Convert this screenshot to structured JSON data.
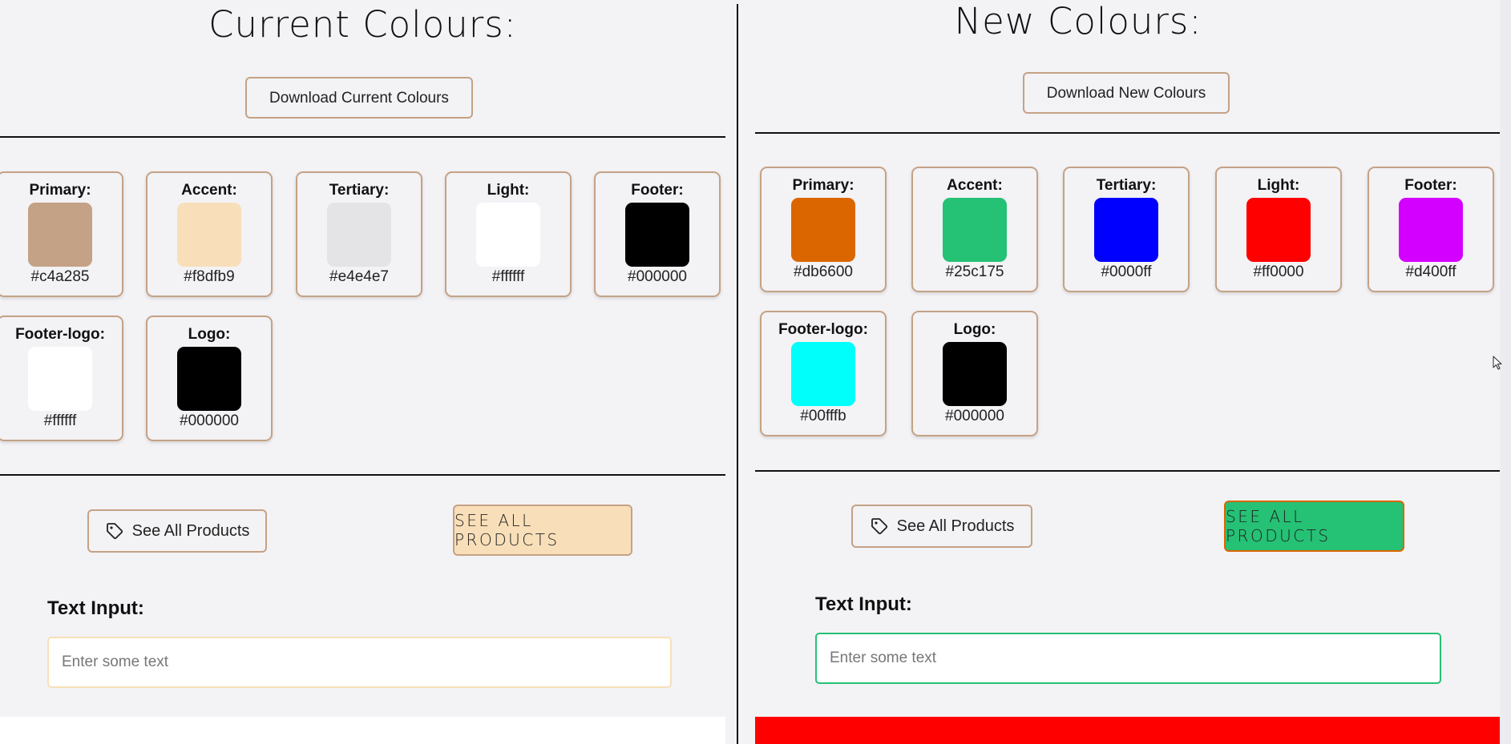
{
  "current": {
    "title": "Current Colours:",
    "download_label": "Download Current Colours",
    "swatches": [
      {
        "label": "Primary:",
        "hex": "#c4a285"
      },
      {
        "label": "Accent:",
        "hex": "#f8dfb9"
      },
      {
        "label": "Tertiary:",
        "hex": "#e4e4e7"
      },
      {
        "label": "Light:",
        "hex": "#ffffff"
      },
      {
        "label": "Footer:",
        "hex": "#000000"
      },
      {
        "label": "Footer-logo:",
        "hex": "#ffffff"
      },
      {
        "label": "Logo:",
        "hex": "#000000"
      }
    ],
    "see_all_label": "See All Products",
    "see_all_big_label": "SEE ALL PRODUCTS",
    "text_input_label": "Text Input:",
    "text_input_placeholder": "Enter some text",
    "accent_color": "#f8dfb9",
    "footer_color": "#ffffff"
  },
  "new": {
    "title": "New Colours:",
    "download_label": "Download New Colours",
    "swatches": [
      {
        "label": "Primary:",
        "hex": "#db6600"
      },
      {
        "label": "Accent:",
        "hex": "#25c175"
      },
      {
        "label": "Tertiary:",
        "hex": "#0000ff"
      },
      {
        "label": "Light:",
        "hex": "#ff0000"
      },
      {
        "label": "Footer:",
        "hex": "#d400ff"
      },
      {
        "label": "Footer-logo:",
        "hex": "#00fffb"
      },
      {
        "label": "Logo:",
        "hex": "#000000"
      }
    ],
    "see_all_label": "See All Products",
    "see_all_big_label": "SEE ALL PRODUCTS",
    "text_input_label": "Text Input:",
    "text_input_placeholder": "Enter some text",
    "accent_color": "#25c175",
    "primary_color": "#db6600",
    "footer_color": "#ff0000"
  },
  "icons": {
    "tag": "tag-icon",
    "cursor": "mouse-pointer-icon"
  }
}
